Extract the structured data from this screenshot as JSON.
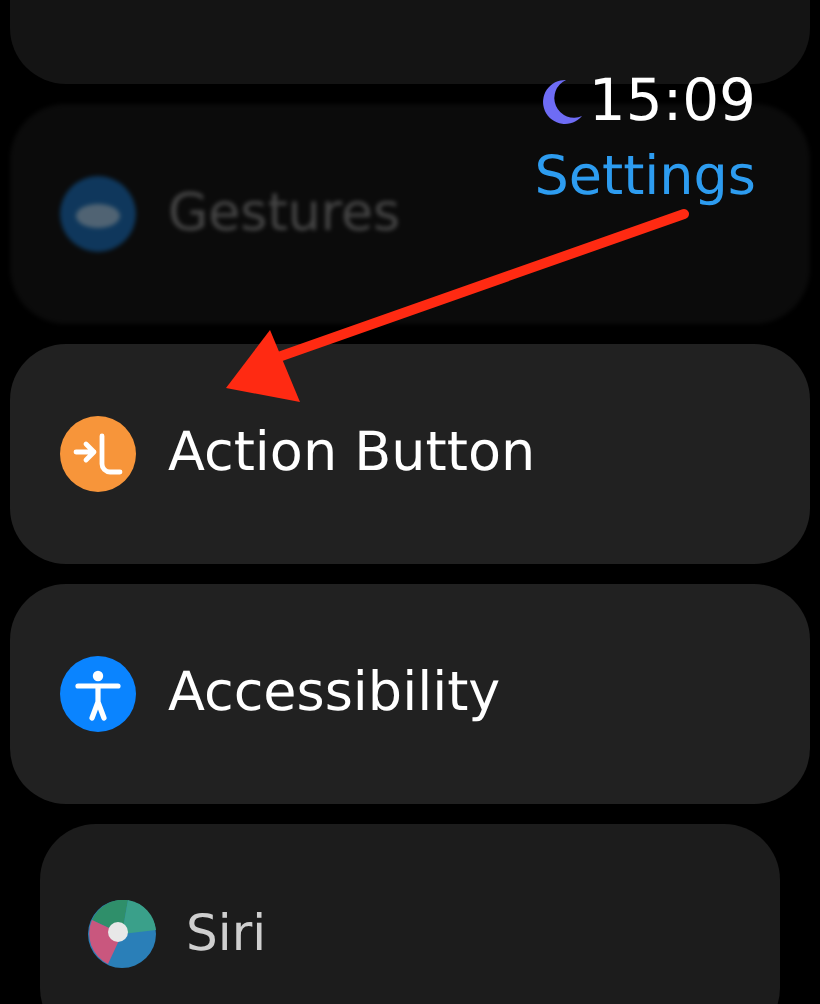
{
  "status": {
    "do_not_disturb": true,
    "time": "15:09"
  },
  "title": "Settings",
  "items": [
    {
      "kind": "gestures",
      "label": "Gestures",
      "faded": true,
      "inset": false
    },
    {
      "kind": "action",
      "label": "Action Button",
      "faded": false,
      "inset": false
    },
    {
      "kind": "accessibility",
      "label": "Accessibility",
      "faded": false,
      "inset": false
    },
    {
      "kind": "siri",
      "label": "Siri",
      "faded": false,
      "inset": true
    }
  ],
  "annotation": {
    "kind": "arrow"
  }
}
